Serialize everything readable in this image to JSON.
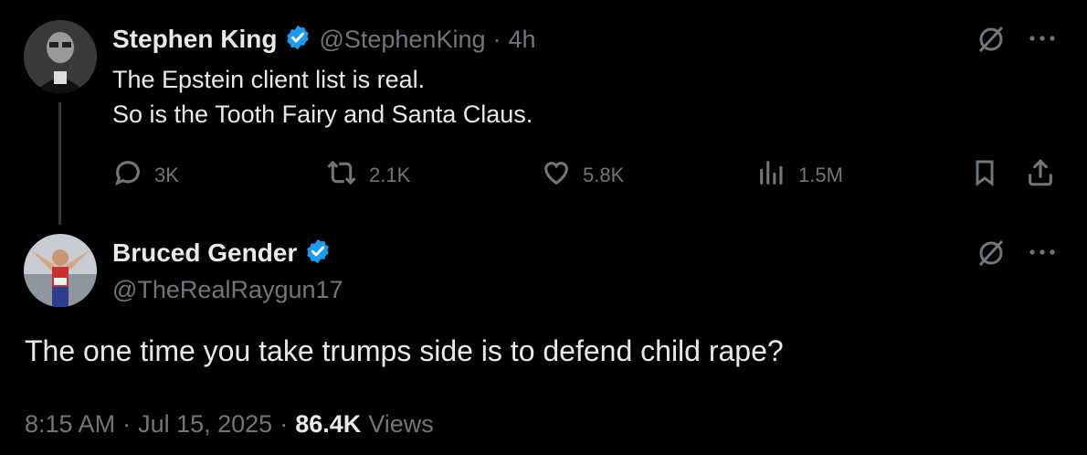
{
  "parent_tweet": {
    "display_name": "Stephen King",
    "handle": "@StephenKing",
    "separator": "·",
    "time_ago": "4h",
    "lines": [
      "The Epstein client list is real.",
      "So is the Tooth Fairy and Santa Claus."
    ],
    "replies": "3K",
    "reposts": "2.1K",
    "likes": "5.8K",
    "views": "1.5M"
  },
  "main_tweet": {
    "display_name": "Bruced Gender",
    "handle": "@TheRealRaygun17",
    "text": "The one time you take trumps side is to defend child rape?",
    "time": "8:15 AM",
    "sep1": "·",
    "date": "Jul 15, 2025",
    "sep2": "·",
    "views_count": "86.4K",
    "views_label": "Views"
  },
  "colors": {
    "background": "#000000",
    "text": "#e7e9ea",
    "muted": "#71767b",
    "verified": "#1d9bf0"
  },
  "icons": [
    "verified-badge-icon",
    "grok-icon",
    "more-icon",
    "reply-icon",
    "repost-icon",
    "like-icon",
    "views-icon",
    "bookmark-icon",
    "share-icon"
  ]
}
